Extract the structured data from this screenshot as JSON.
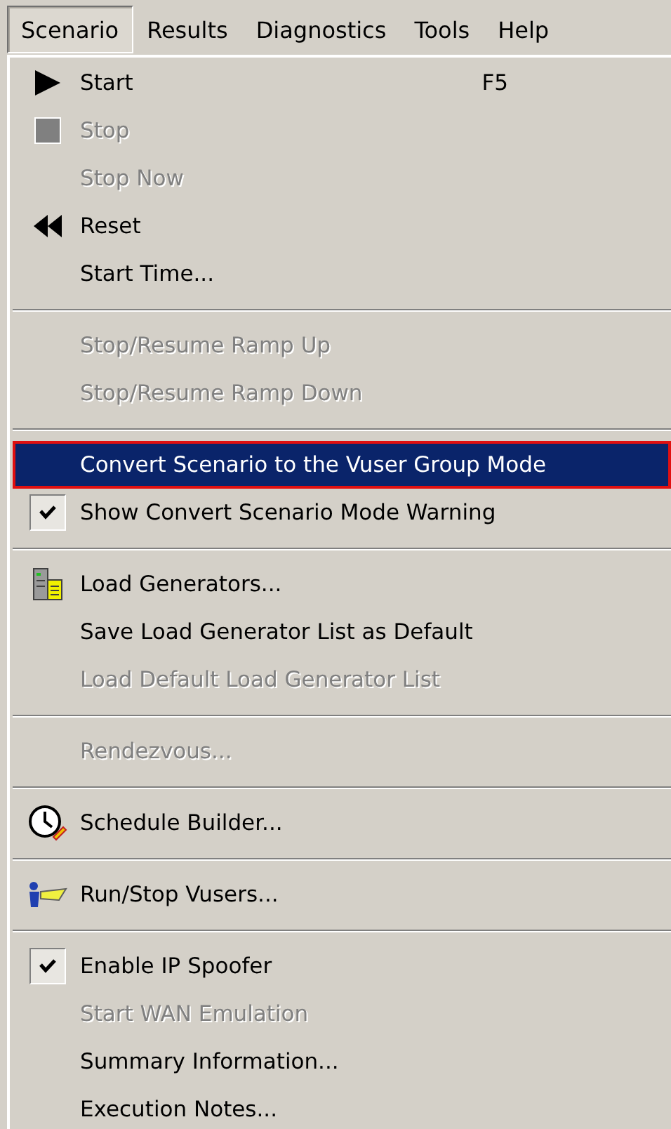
{
  "menubar": [
    {
      "label": "Scenario",
      "selected": true
    },
    {
      "label": "Results",
      "selected": false
    },
    {
      "label": "Diagnostics",
      "selected": false
    },
    {
      "label": "Tools",
      "selected": false
    },
    {
      "label": "Help",
      "selected": false
    }
  ],
  "menu": [
    {
      "kind": "item",
      "label": "Start",
      "shortcut": "F5",
      "disabled": false,
      "selected": false
    },
    {
      "kind": "item",
      "label": "Stop",
      "disabled": true,
      "selected": false
    },
    {
      "kind": "item",
      "label": "Stop Now",
      "disabled": true,
      "selected": false
    },
    {
      "kind": "item",
      "label": "Reset",
      "disabled": false,
      "selected": false
    },
    {
      "kind": "item",
      "label": "Start Time...",
      "disabled": false,
      "selected": false
    },
    {
      "kind": "separator"
    },
    {
      "kind": "item",
      "label": "Stop/Resume Ramp Up",
      "disabled": true,
      "selected": false
    },
    {
      "kind": "item",
      "label": "Stop/Resume Ramp Down",
      "disabled": true,
      "selected": false
    },
    {
      "kind": "separator"
    },
    {
      "kind": "item",
      "label": "Convert Scenario to the Vuser Group Mode",
      "disabled": false,
      "selected": true
    },
    {
      "kind": "check",
      "label": "Show Convert Scenario Mode Warning",
      "checked": true,
      "disabled": false,
      "selected": false
    },
    {
      "kind": "separator"
    },
    {
      "kind": "item",
      "label": "Load Generators...",
      "disabled": false,
      "selected": false
    },
    {
      "kind": "item",
      "label": "Save Load Generator List as Default",
      "disabled": false,
      "selected": false
    },
    {
      "kind": "item",
      "label": "Load Default Load Generator List",
      "disabled": true,
      "selected": false
    },
    {
      "kind": "separator"
    },
    {
      "kind": "item",
      "label": "Rendezvous...",
      "disabled": true,
      "selected": false
    },
    {
      "kind": "separator"
    },
    {
      "kind": "item",
      "label": "Schedule Builder...",
      "disabled": false,
      "selected": false
    },
    {
      "kind": "separator"
    },
    {
      "kind": "item",
      "label": "Run/Stop Vusers...",
      "disabled": false,
      "selected": false
    },
    {
      "kind": "separator"
    },
    {
      "kind": "check",
      "label": "Enable IP Spoofer",
      "checked": true,
      "disabled": false,
      "selected": false
    },
    {
      "kind": "item",
      "label": "Start WAN Emulation",
      "disabled": true,
      "selected": false
    },
    {
      "kind": "item",
      "label": "Summary Information...",
      "disabled": false,
      "selected": false
    },
    {
      "kind": "item",
      "label": "Execution Notes...",
      "disabled": false,
      "selected": false
    }
  ]
}
